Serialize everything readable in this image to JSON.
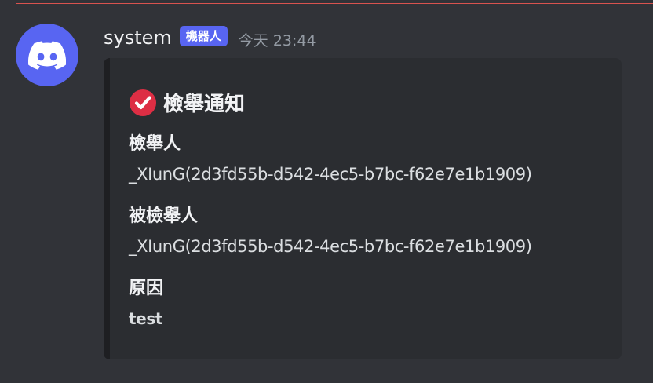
{
  "message": {
    "author": "system",
    "bot_tag": "機器人",
    "timestamp": "今天 23:44",
    "avatar_icon": "discord-logo-icon",
    "avatar_color": "#5865f2"
  },
  "embed": {
    "title": "檢舉通知",
    "title_icon": "check-mark-icon",
    "fields": [
      {
        "name": "檢舉人",
        "value": "_XIunG(2d3fd55b-d542-4ec5-b7bc-f62e7e1b1909)"
      },
      {
        "name": "被檢舉人",
        "value": "_XIunG(2d3fd55b-d542-4ec5-b7bc-f62e7e1b1909)"
      },
      {
        "name": "原因",
        "value": "test"
      }
    ]
  },
  "colors": {
    "background": "#313338",
    "embed_background": "#2b2d31",
    "accent": "#5865f2",
    "check_red": "#dd2e44",
    "divider": "#d9534f"
  }
}
